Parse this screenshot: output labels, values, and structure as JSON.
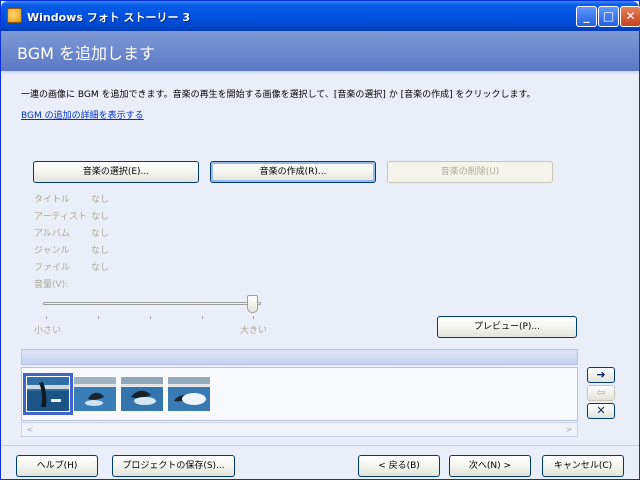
{
  "window": {
    "title": "Windows フォト ストーリー 3",
    "minimize": "_",
    "maximize": "□",
    "close": "✕"
  },
  "header": {
    "title": "BGM を追加します"
  },
  "instruction": "一連の画像に BGM を追加できます。音楽の再生を開始する画像を選択して、[音楽の選択] か [音楽の作成] をクリックします。",
  "details_link": "BGM の追加の詳細を表示する",
  "music_buttons": {
    "select": "音楽の選択(E)...",
    "create": "音楽の作成(R)...",
    "delete": "音楽の削除(U)"
  },
  "music_info": [
    {
      "label": "タイトル",
      "value": "なし"
    },
    {
      "label": "アーティスト",
      "value": "なし"
    },
    {
      "label": "アルバム",
      "value": "なし"
    },
    {
      "label": "ジャンル",
      "value": "なし"
    },
    {
      "label": "ファイル",
      "value": "なし"
    }
  ],
  "volume": {
    "label": "音量(V):",
    "min_label": "小さい",
    "max_label": "大きい",
    "level": 1.0
  },
  "preview_button": "プレビュー(P)...",
  "timeline": {
    "thumbnails": [
      {
        "name": "dolphin-photo-1",
        "selected": true
      },
      {
        "name": "dolphin-photo-2",
        "selected": false
      },
      {
        "name": "dolphin-photo-3",
        "selected": false
      },
      {
        "name": "dolphin-photo-4",
        "selected": false
      }
    ],
    "scroll_left": "<",
    "scroll_right": ">"
  },
  "side_buttons": {
    "move_right": "➜",
    "move_left": "⇦",
    "delete": "✕"
  },
  "footer": {
    "help": "ヘルプ(H)",
    "save_project": "プロジェクトの保存(S)...",
    "back": "< 戻る(B)",
    "next": "次へ(N) >",
    "cancel": "キャンセル(C)"
  },
  "colors": {
    "title_bar": "#0054e3",
    "header_band": "#6e88cc",
    "link": "#0033cc",
    "selection": "#4064c8"
  }
}
